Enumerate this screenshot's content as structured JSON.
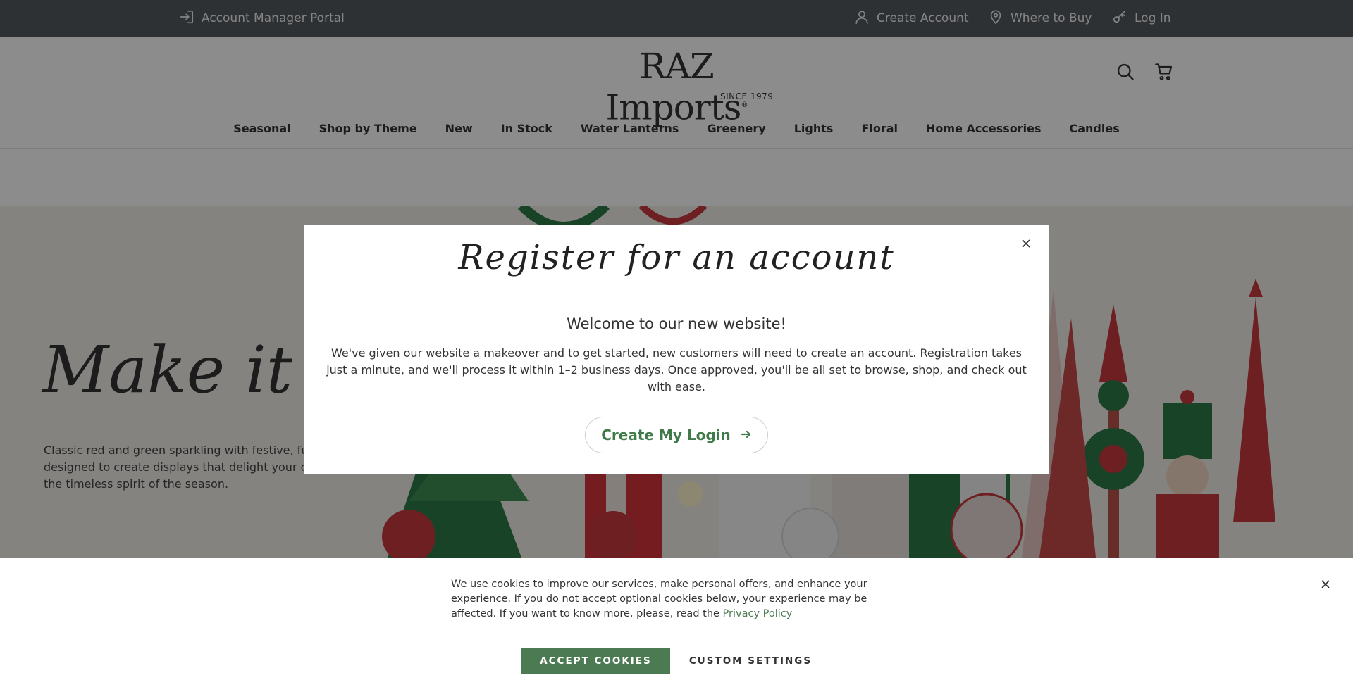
{
  "topbar": {
    "portal_label": "Account Manager Portal",
    "create_account_label": "Create Account",
    "where_to_buy_label": "Where to Buy",
    "login_label": "Log In",
    "icons": [
      "sign-in-icon",
      "user-icon",
      "map-pin-icon",
      "key-icon"
    ]
  },
  "header": {
    "logo_text": "RAZ Imports",
    "logo_reg": "®",
    "logo_since": "SINCE 1979",
    "icons": [
      "search-icon",
      "cart-icon"
    ]
  },
  "nav": {
    "items": [
      "Seasonal",
      "Shop by Theme",
      "New",
      "In Stock",
      "Water Lanterns",
      "Greenery",
      "Lights",
      "Floral",
      "Home Accessories",
      "Candles"
    ]
  },
  "hero": {
    "title": "Make it Me",
    "text": "Classic red and green sparkling with festive, fun designed to create displays that delight your c capture the timeless spirit of the season."
  },
  "modal": {
    "title": "Register for an account",
    "subtitle": "Welcome to our new website!",
    "body": "We've given our website a makeover and to get started, new customers will need to create an account. Registration takes just a minute, and we'll process it within 1–2 business days. Once approved, you'll be all set to browse, shop, and check out with ease.",
    "button_label": "Create My Login",
    "button_icon": "arrow-right-icon",
    "close_icon": "close-icon"
  },
  "cookie": {
    "text": "We use cookies to improve our services, make personal offers, and enhance your experience. If you do not accept optional cookies below, your experience may be affected. If you want to know more, please, read the",
    "link_label": "Privacy Policy",
    "accept_label": "ACCEPT COOKIES",
    "custom_label": "CUSTOM SETTINGS",
    "close_icon": "close-icon"
  },
  "colors": {
    "topbar_bg": "#555a60",
    "accent_green": "#4c7a52",
    "overlay": "rgba(0,0,0,0.45)"
  }
}
